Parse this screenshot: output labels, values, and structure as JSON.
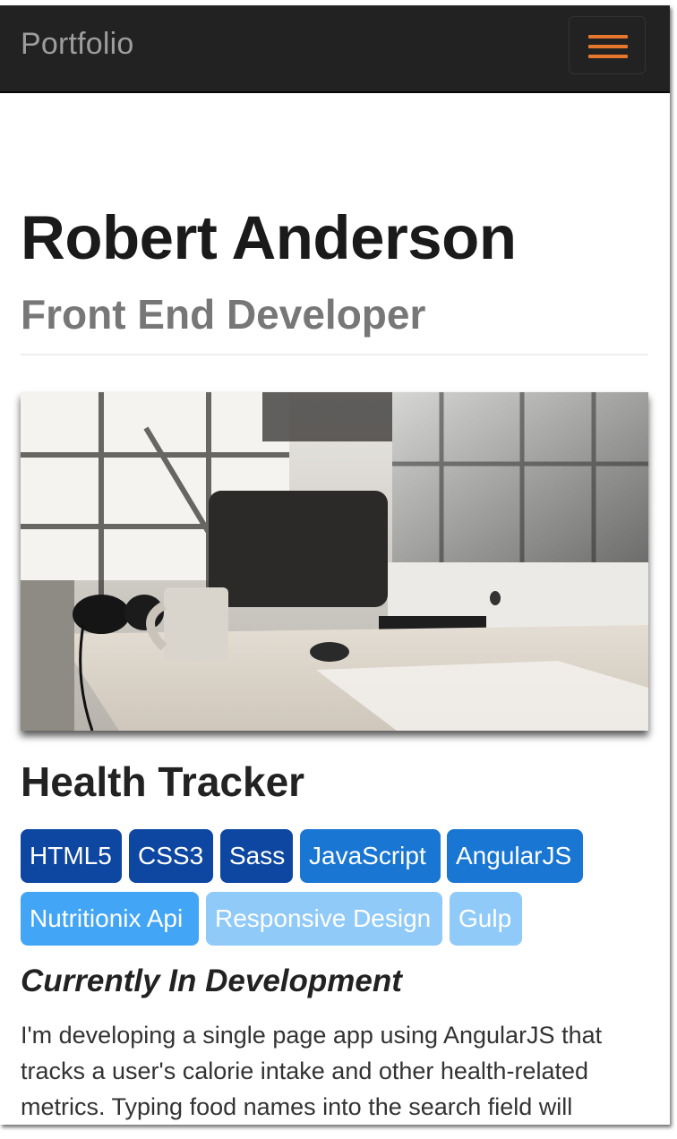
{
  "navbar": {
    "brand": "Portfolio",
    "toggle_icon": "hamburger-menu-icon",
    "toggle_color": "#e8772e"
  },
  "header": {
    "name": "Robert Anderson",
    "role": "Front End Developer"
  },
  "project": {
    "image_alt": "workspace-desk-photo",
    "title": "Health Tracker",
    "tags": [
      {
        "label": "HTML5",
        "color": "#0d47a1"
      },
      {
        "label": "CSS3",
        "color": "#0d47a1"
      },
      {
        "label": "Sass",
        "color": "#0d47a1"
      },
      {
        "label": "JavaScript",
        "color": "#1976d2"
      },
      {
        "label": "AngularJS",
        "color": "#1976d2"
      },
      {
        "label": "Nutritionix Api",
        "color": "#42a5f5"
      },
      {
        "label": "Responsive Design",
        "color": "#90caf9"
      },
      {
        "label": "Gulp",
        "color": "#90caf9"
      }
    ],
    "status": "Currently In Development",
    "description_lines": [
      "I'm developing a single page app using AngularJS that",
      "tracks a user's calorie intake and other health-related",
      "metrics. Typing food names into the search field will"
    ]
  }
}
